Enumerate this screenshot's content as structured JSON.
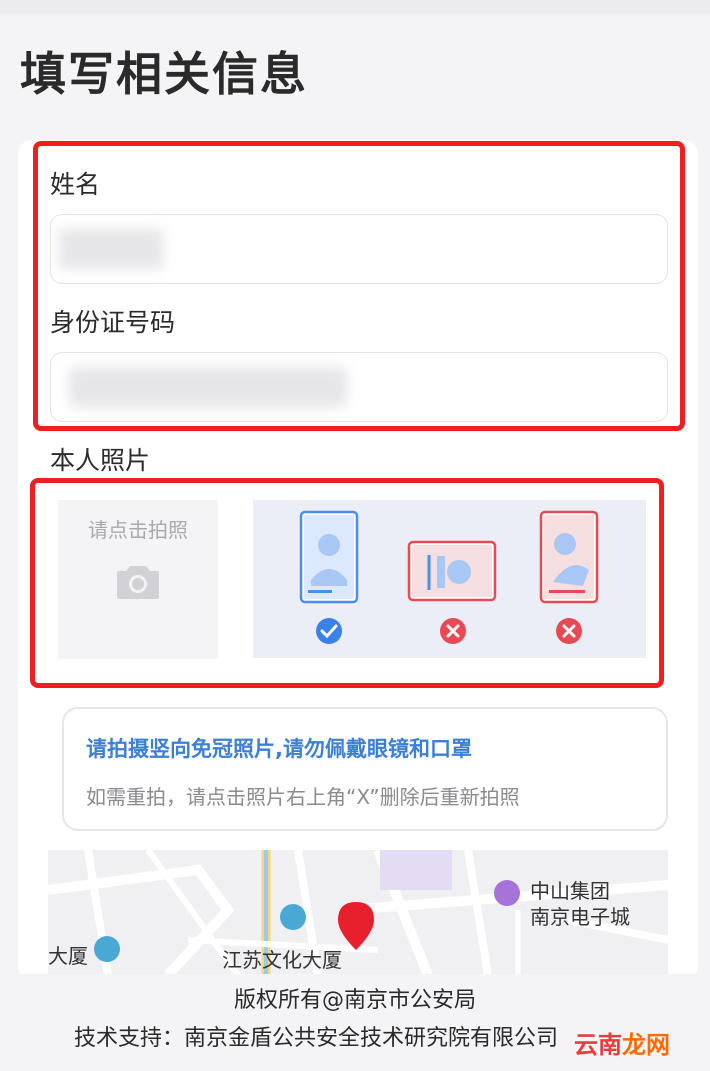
{
  "page": {
    "title": "填写相关信息"
  },
  "form": {
    "name_label": "姓名",
    "id_label": "身份证号码",
    "photo_label": "本人照片",
    "photo_button_text": "请点击拍照"
  },
  "tip": {
    "main": "请拍摄竖向免冠照片,请勿佩戴眼镜和口罩",
    "sub": "如需重拍，请点击照片右上角“X”删除后重新拍照"
  },
  "map": {
    "poi1_line1": "中山集团",
    "poi1_line2": "南京电子城",
    "poi2": "江苏文化大厦",
    "poi3": "大厦"
  },
  "footer": {
    "copyright": "版权所有@南京市公安局",
    "support": "技术支持：南京金盾公共安全技术研究院有限公司"
  },
  "watermark": {
    "part1": "云南",
    "part2": "龙网"
  },
  "colors": {
    "accent": "#3b7fd6",
    "highlight_red": "#ef1f1f",
    "ok_blue": "#3b82e8",
    "bad_red": "#e84a55"
  }
}
